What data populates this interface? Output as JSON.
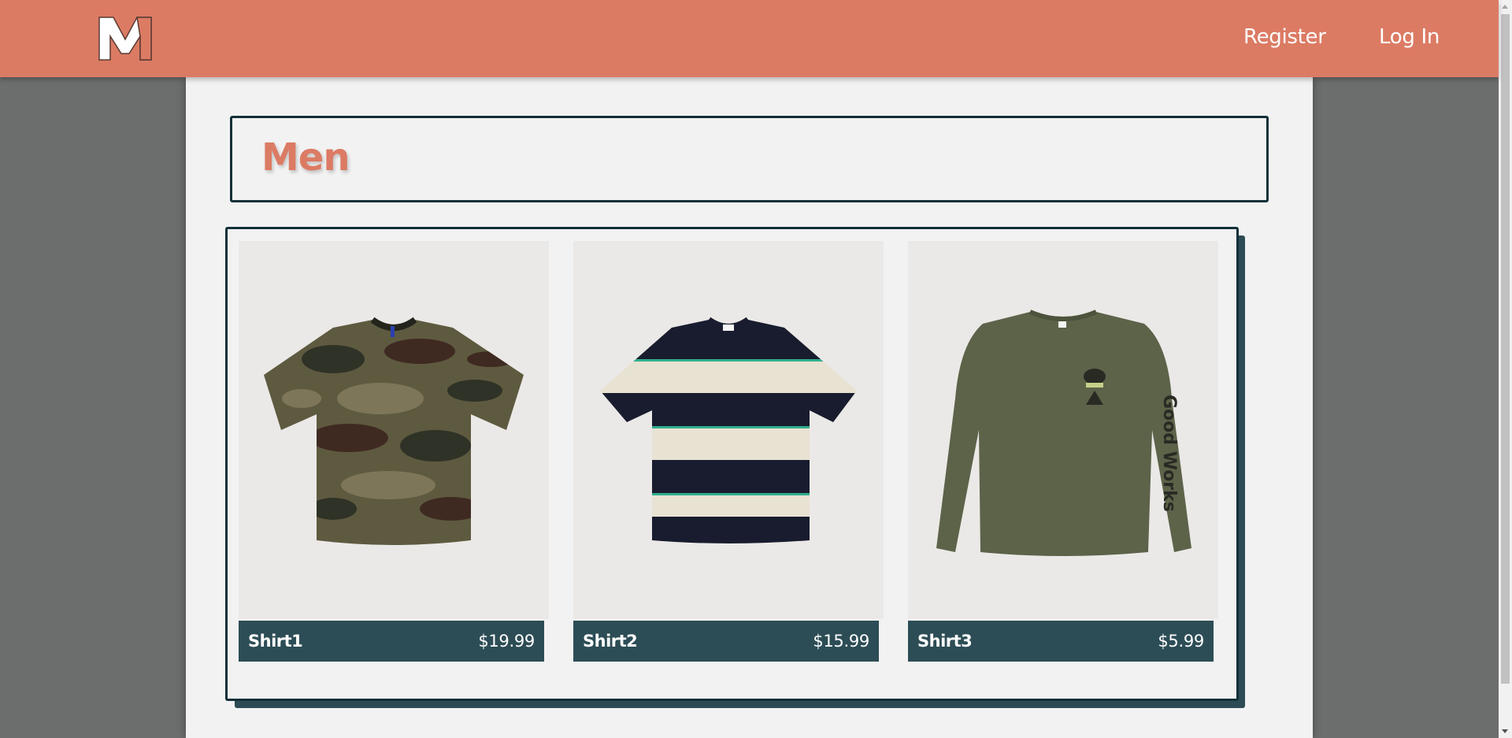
{
  "header": {
    "logo_letter": "M",
    "nav": {
      "register": "Register",
      "login": "Log In"
    }
  },
  "page": {
    "title": "Men"
  },
  "products": [
    {
      "name": "Shirt1",
      "price": "$19.99",
      "image": "camo-tshirt"
    },
    {
      "name": "Shirt2",
      "price": "$15.99",
      "image": "striped-tshirt"
    },
    {
      "name": "Shirt3",
      "price": "$5.99",
      "image": "olive-longsleeve",
      "print_text": "Good Works"
    }
  ],
  "colors": {
    "header": "#dc7b64",
    "accent": "#dc7b64",
    "dark_teal": "#2d4d56",
    "border": "#123038",
    "panel": "#f2f2f2",
    "background": "#6b6e6d"
  }
}
